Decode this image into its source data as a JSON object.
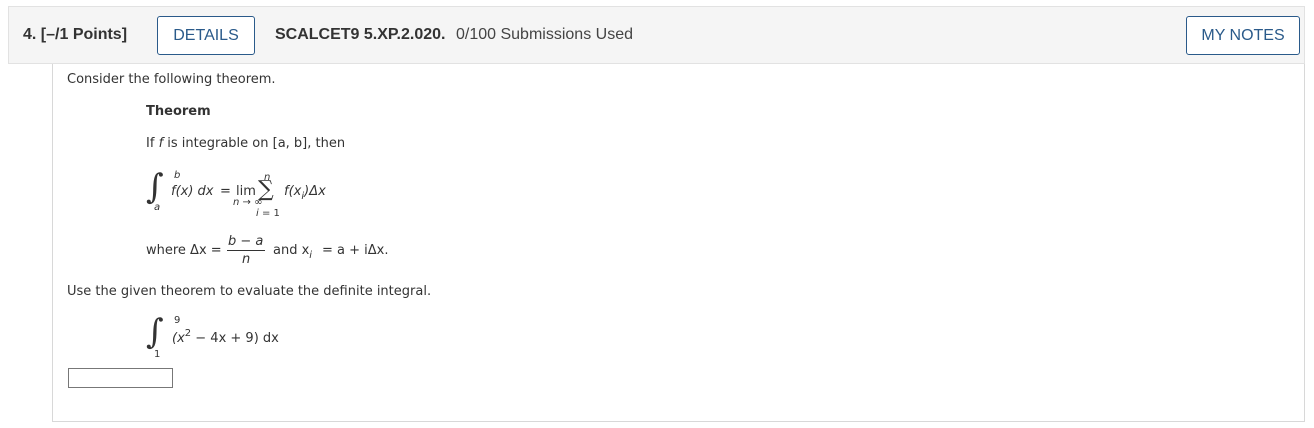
{
  "header": {
    "question_number": "4.",
    "points": "[–/1 Points]",
    "details_label": "DETAILS",
    "problem_code": "SCALCET9 5.XP.2.020.",
    "submissions": "0/100 Submissions Used",
    "notes_label": "MY NOTES"
  },
  "content": {
    "intro": "Consider the following theorem.",
    "theorem_title": "Theorem",
    "theorem_if": "If",
    "theorem_f": "f",
    "theorem_rest": "is integrable on [a, b], then",
    "formula": {
      "upper": "b",
      "lower": "a",
      "integrand": "f(x) dx",
      "equals": "=",
      "lim": "lim",
      "lim_sub": "n → ∞",
      "sigma_top": "n",
      "sigma_bottom": "i = 1",
      "summand": "f(x",
      "summand_sub": "i",
      "summand_end": ")Δx"
    },
    "where": {
      "where_text": "where Δx =",
      "numerator": "b − a",
      "denominator": "n",
      "and_text": "and x",
      "x_sub": "i",
      "rest": "= a + iΔx."
    },
    "instruction": "Use the given theorem to evaluate the definite integral.",
    "integral": {
      "upper": "9",
      "lower": "1",
      "integrand_pre": "(x",
      "exp": "2",
      "integrand_post": " − 4x + 9) dx"
    },
    "answer_value": ""
  }
}
